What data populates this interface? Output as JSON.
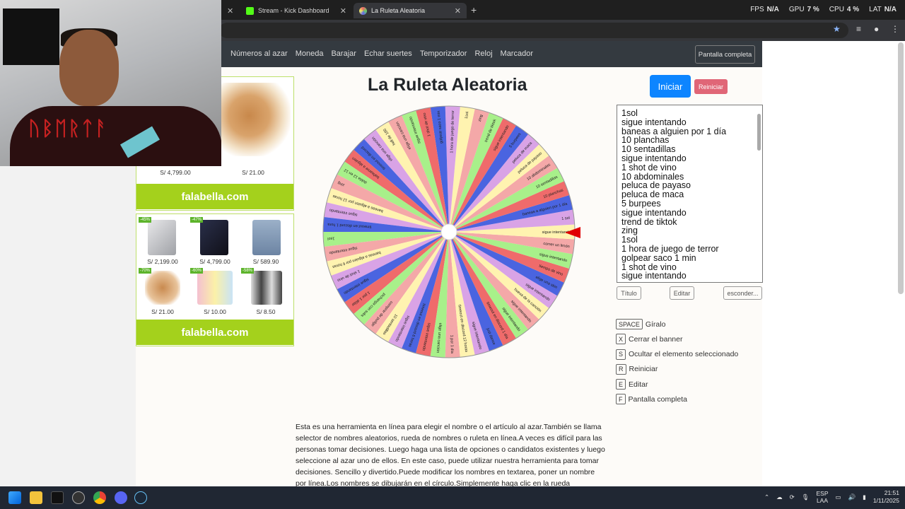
{
  "browser": {
    "tabs": [
      {
        "label": "Stream - Kick Dashboard",
        "icon": "kick-icon"
      },
      {
        "label": "La Ruleta Aleatoria",
        "icon": "roulette-icon"
      }
    ],
    "stats": {
      "fps_label": "FPS",
      "fps": "N/A",
      "gpu_label": "GPU",
      "gpu": "7 %",
      "cpu_label": "CPU",
      "cpu": "4 %",
      "lat_label": "LAT",
      "lat": "N/A"
    }
  },
  "nav": {
    "links": [
      "Números al azar",
      "Moneda",
      "Barajar",
      "Echar suertes",
      "Temporizador",
      "Reloj",
      "Marcador"
    ],
    "fullscreen": "Pantalla completa"
  },
  "ads": {
    "brand": "falabella.com",
    "top_prices": [
      "S/ 4,799.00",
      "S/ 21.00"
    ],
    "grid": [
      {
        "badge": "-45%",
        "price": "S/ 2,199.00"
      },
      {
        "badge": "-47%",
        "price": "S/ 4,799.00"
      },
      {
        "badge": "",
        "price": "S/ 589.90"
      },
      {
        "badge": "-70%",
        "price": "S/ 21.00"
      },
      {
        "badge": "-60%",
        "price": "S/ 10.00"
      },
      {
        "badge": "-58%",
        "price": "S/ 8.50"
      }
    ]
  },
  "main": {
    "title": "La Ruleta Aleatoria",
    "start": "Iniciar",
    "reset": "Reiniciar"
  },
  "wheel": {
    "colors": [
      "#a8f08a",
      "#f4a8a8",
      "#fff3b0",
      "#d9a3e6",
      "#4a64e0",
      "#ef6b6b"
    ],
    "segments": [
      "1sol",
      "sigue intentando",
      "baneas a alguien por 6 horas",
      "1 shot de vino",
      "sigue intentando",
      "1 por 1 dólar",
      "pichanga con subs",
      "comprar de pudge",
      "10 sentadillas",
      "sigue intentando",
      "timeout en discord 6 horas",
      "sigue intentando",
      "elige una canción",
      "1 por 1 día",
      "timeout en discord 12 horas",
      "sigue intentando",
      "just dance",
      "timeout en discord 1 día",
      "sigue intentando",
      "sigue intentando",
      "hueva de la canción",
      "sigue intentando",
      "elige una skin",
      "tiempo de vino",
      "sigue intentando",
      "comer un limón",
      "sigue intentando",
      "1 sol",
      "baneas a alguien por 1 día",
      "10 planchas",
      "10 sentadillas",
      "10 abdominales",
      "peluca de payaso",
      "peluca de maca",
      "5 burpees",
      "sigue intentando",
      "trend de tiktok",
      "zing",
      "1sol",
      "1 hora de juego de terror",
      "golpear saco 1 min",
      "1 shot de vino",
      "sigue intentando",
      "elige una canción",
      "hell de 100",
      "elige una canción",
      "timeout en discord",
      "bañearse a alguien",
      "dobla 12 en 12",
      "zing",
      "baneas a alguien por 12 horas",
      "sigue intentando",
      "timeout en discord 1 hora"
    ]
  },
  "names": [
    "1sol",
    "sigue intentando",
    "baneas a alguien por 1 día",
    "10 planchas",
    "10 sentadillas",
    "sigue intentando",
    "1 shot de vino",
    "10 abdominales",
    "peluca de payaso",
    "peluca de maca",
    "5 burpees",
    "sigue intentando",
    "trend de tiktok",
    "zing",
    "1sol",
    "1 hora de juego de terror",
    "golpear saco 1 min",
    "1 shot de vino",
    "sigue intentando"
  ],
  "buttons": {
    "title": "Título",
    "edit": "Editar",
    "hide": "esconder..."
  },
  "shortcuts": [
    {
      "key": "SPACE",
      "label": "Gíralo"
    },
    {
      "key": "X",
      "label": "Cerrar el banner"
    },
    {
      "key": "S",
      "label": "Ocultar el elemento seleccionado"
    },
    {
      "key": "R",
      "label": "Reiniciar"
    },
    {
      "key": "E",
      "label": "Editar"
    },
    {
      "key": "F",
      "label": "Pantalla completa"
    }
  ],
  "description": "Esta es una herramienta en línea para elegir el nombre o el artículo al azar.También se llama selector de nombres aleatorios, rueda de nombres o ruleta en línea.A veces es difícil para las personas tomar decisiones. Luego haga una lista de opciones o candidatos existentes y luego seleccione al azar uno de ellos. En este caso, puede utilizar nuestra herramienta para tomar decisiones. Sencillo y divertido.Puede modificar los nombres en textarea, poner un nombre por línea.Los nombres se dibujarán en el círculo.Simplemente haga clic en la rueda",
  "taskbar": {
    "lang1": "ESP",
    "lang2": "LAA",
    "time": "21:51",
    "date": "1/11/2025"
  }
}
